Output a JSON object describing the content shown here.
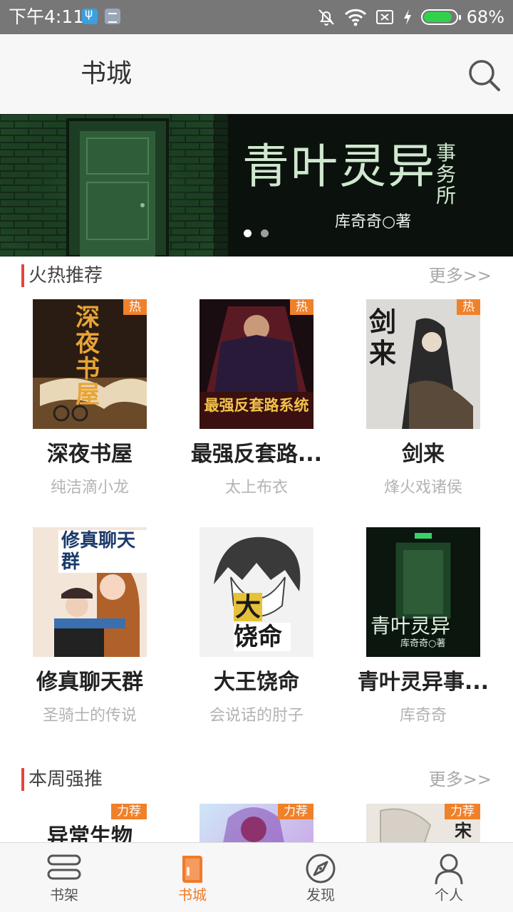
{
  "status_bar": {
    "time": "下午4:11",
    "battery": "68%",
    "battery_level": 0.68,
    "icons": [
      "usb-icon",
      "notification-icon",
      "mute-icon",
      "wifi-icon",
      "no-sim-icon",
      "charging-icon",
      "battery-icon"
    ]
  },
  "header": {
    "title": "书城",
    "search_icon": "search-icon"
  },
  "banner": {
    "title": "青叶灵异",
    "subtitle": "事务所",
    "author": "库奇奇○著",
    "page_count": 2,
    "active_page": 1
  },
  "sections": [
    {
      "title": "火热推荐",
      "more": "更多>>",
      "books": [
        {
          "title": "深夜书屋",
          "author": "纯洁滴小龙",
          "tag": "热"
        },
        {
          "title": "最强反套路...",
          "author": "太上布衣",
          "tag": "热"
        },
        {
          "title": "剑来",
          "author": "烽火戏诸侯",
          "tag": "热"
        },
        {
          "title": "修真聊天群",
          "author": "圣骑士的传说",
          "tag": ""
        },
        {
          "title": "大王饶命",
          "author": "会说话的肘子",
          "tag": ""
        },
        {
          "title": "青叶灵异事...",
          "author": "库奇奇",
          "tag": ""
        }
      ]
    },
    {
      "title": "本周强推",
      "more": "更多>>",
      "books": [
        {
          "tag": "力荐"
        },
        {
          "tag": "力荐"
        },
        {
          "tag": "力荐"
        }
      ]
    }
  ],
  "covers": {
    "c1": "深夜书屋",
    "c2": "最强反套路系统",
    "c3": "剑来",
    "c4": "修真聊天群",
    "c5a": "大王",
    "c5b": "饶命",
    "c6": "青叶灵异",
    "c6b": "库奇奇○著",
    "c7": "异常生物",
    "c9": "宋"
  },
  "bottom_nav": [
    {
      "label": "书架",
      "icon": "bookshelf-icon",
      "active": false
    },
    {
      "label": "书城",
      "icon": "bookstore-icon",
      "active": true
    },
    {
      "label": "发现",
      "icon": "compass-icon",
      "active": false
    },
    {
      "label": "个人",
      "icon": "person-icon",
      "active": false
    }
  ],
  "colors": {
    "accent": "#f07a2a",
    "section_bar": "#e0473d",
    "tag": "#f0812b",
    "status_bar": "#777777"
  }
}
